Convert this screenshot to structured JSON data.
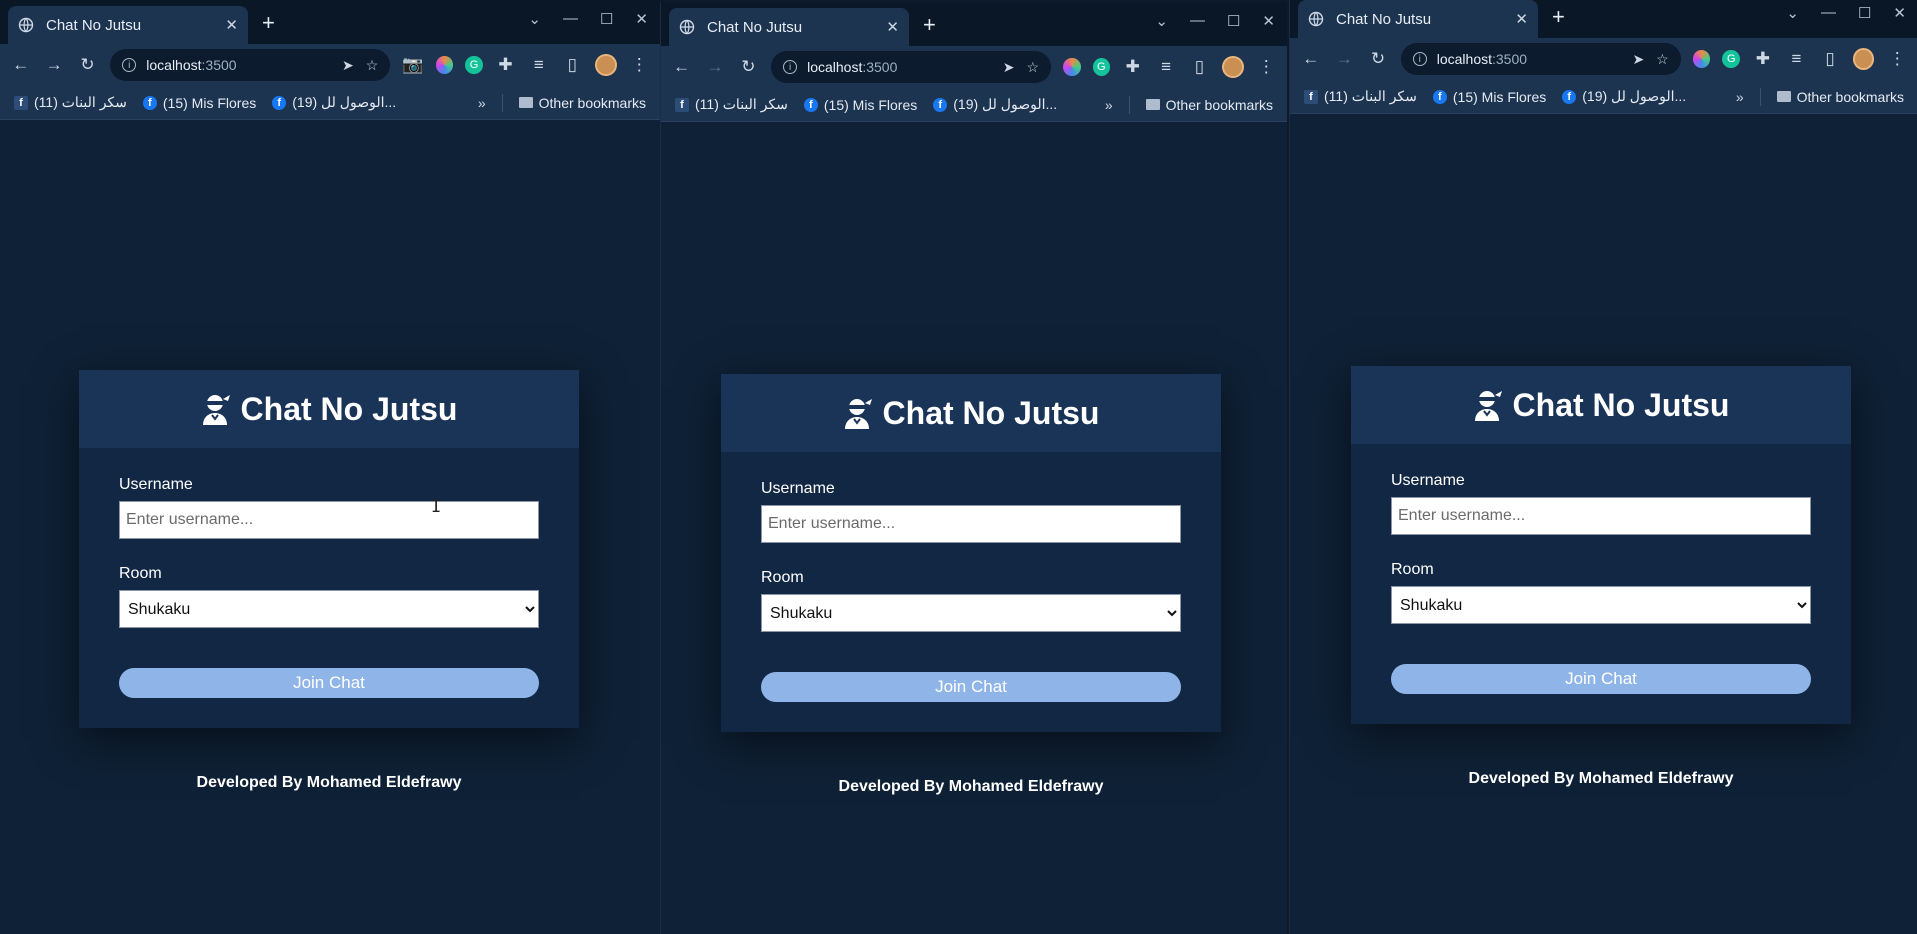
{
  "browser": {
    "tab_title": "Chat No Jutsu",
    "url_host": "localhost",
    "url_port": ":3500",
    "bookmarks": [
      {
        "label": "(11) سكر البنات",
        "icon": "facebook-square-icon"
      },
      {
        "label": "(15) Mis Flores",
        "icon": "facebook-icon"
      },
      {
        "label": "(19) الوصول لل...",
        "icon": "facebook-icon"
      }
    ],
    "more_bookmarks": "»",
    "other_bookmarks": "Other bookmarks",
    "colors": {
      "frame": "#0a1727",
      "toolbar": "#1d3450",
      "page": "#0f2136"
    }
  },
  "app": {
    "title": "Chat No Jutsu",
    "username_label": "Username",
    "username_placeholder": "Enter username...",
    "room_label": "Room",
    "room_selected": "Shukaku",
    "join_button": "Join Chat",
    "footer": "Developed By Mohamed Eldefrawy",
    "colors": {
      "card": "#112743",
      "card_header": "#1a3458",
      "button": "#8fb5e8"
    }
  }
}
